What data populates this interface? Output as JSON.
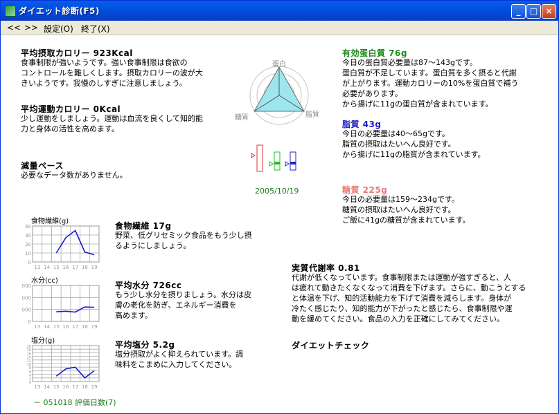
{
  "window": {
    "title": "ダイエット診断(F5)"
  },
  "menu": {
    "prev": "<<",
    "next": ">>",
    "settings": "設定(O)",
    "exit": "終了(X)"
  },
  "calorie": {
    "title": "平均摂取カロリー 923Kcal",
    "text": "食事制限が強いようです。強い食事制限は食欲の\nコントロールを難しくします。摂取カロリーの波が大\nきいようです。我慢のしすぎに注意しましょう。"
  },
  "exercise": {
    "title": "平均運動カロリー 0Kcal",
    "text": "少し運動をしましょう。運動は血流を良くして知的能\n力と身体の活性を高めます。"
  },
  "weight_pace": {
    "title": "減量ペース",
    "text": "必要なデータ数がありません。"
  },
  "radar": {
    "label_top": "蛋白",
    "label_right": "脂質",
    "label_left": "糖質"
  },
  "date": "2005/10/19",
  "protein": {
    "title": "有効蛋白質 76g",
    "color": "#1a8a1a",
    "text": "今日の蛋白質必要量は87～143gです。\n蛋白質が不足しています。蛋白質を多く摂ると代謝\nが上がります。運動カロリーの10%を蛋白質で補う\n必要があります。\nから揚げに11gの蛋白質が含まれています。"
  },
  "fat": {
    "title": "脂質 43g",
    "color": "#1a1acc",
    "text": "今日の必要量は40～65gです。\n脂質の摂取はたいへん良好です。\nから揚げに11gの脂質が含まれています。"
  },
  "sugar": {
    "title": "糖質 225g",
    "color": "#ee7777",
    "text": "今日の必要量は159～234gです。\n糖質の摂取はたいへん良好です。\nご飯に41gの糖質が含まれています。"
  },
  "fiber": {
    "title": "食物繊維 17g",
    "text": "野菜、低グリセミック食品をもう少し摂\nるようにしましょう。"
  },
  "water": {
    "title": "平均水分 726cc",
    "text": "もう少し水分を摂りましょう。水分は皮\n膚の老化を防ぎ、エネルギー消費を\n高めます。"
  },
  "salt": {
    "title": "平均塩分 5.2g",
    "text": "塩分摂取がよく抑えられています。調\n味料をこまめに入力してください。"
  },
  "metabolism": {
    "title": "実質代謝率 0.81",
    "text": "代謝が低くなっています。食事制限または運動が強すぎると、人\nは疲れて動きたくなくなって消費を下げます。さらに、動こうとする\nと体温を下げ、知的活動能力を下げて消費を減らします。身体が\n冷たく感じたり、知的能力が下がったと感じたら、食事制限や運\n動を緩めてください。食品の入力を正確にしてみてください。"
  },
  "diet_check": {
    "title": "ダイエットチェック"
  },
  "footer": {
    "text": "－ 051018 評価日数(7)"
  },
  "chart_data": [
    {
      "type": "line",
      "title": "食物繊維(g)",
      "x": [
        "13",
        "14",
        "15",
        "16",
        "17",
        "18",
        "19"
      ],
      "ylim": [
        0,
        40
      ],
      "yticks": [
        "40",
        "30",
        "20",
        "10",
        "0"
      ],
      "values": [
        null,
        null,
        10,
        27,
        35,
        11,
        8
      ]
    },
    {
      "type": "line",
      "title": "水分(cc)",
      "x": [
        "13",
        "14",
        "15",
        "16",
        "17",
        "18",
        "19"
      ],
      "ylim": [
        0,
        3000
      ],
      "yticks": [
        "3000",
        "2000",
        "1000",
        "0"
      ],
      "values": [
        null,
        null,
        800,
        850,
        780,
        1200,
        1180
      ]
    },
    {
      "type": "line",
      "title": "塩分(g)",
      "x": [
        "13",
        "14",
        "15",
        "16",
        "17",
        "18",
        "19"
      ],
      "ylim": [
        0,
        20
      ],
      "yticks": [
        "20",
        "18",
        "16",
        "14",
        "12",
        "10",
        "8",
        "6",
        "4",
        "2",
        "0"
      ],
      "values": [
        null,
        null,
        3,
        7,
        8,
        2,
        6
      ]
    }
  ]
}
